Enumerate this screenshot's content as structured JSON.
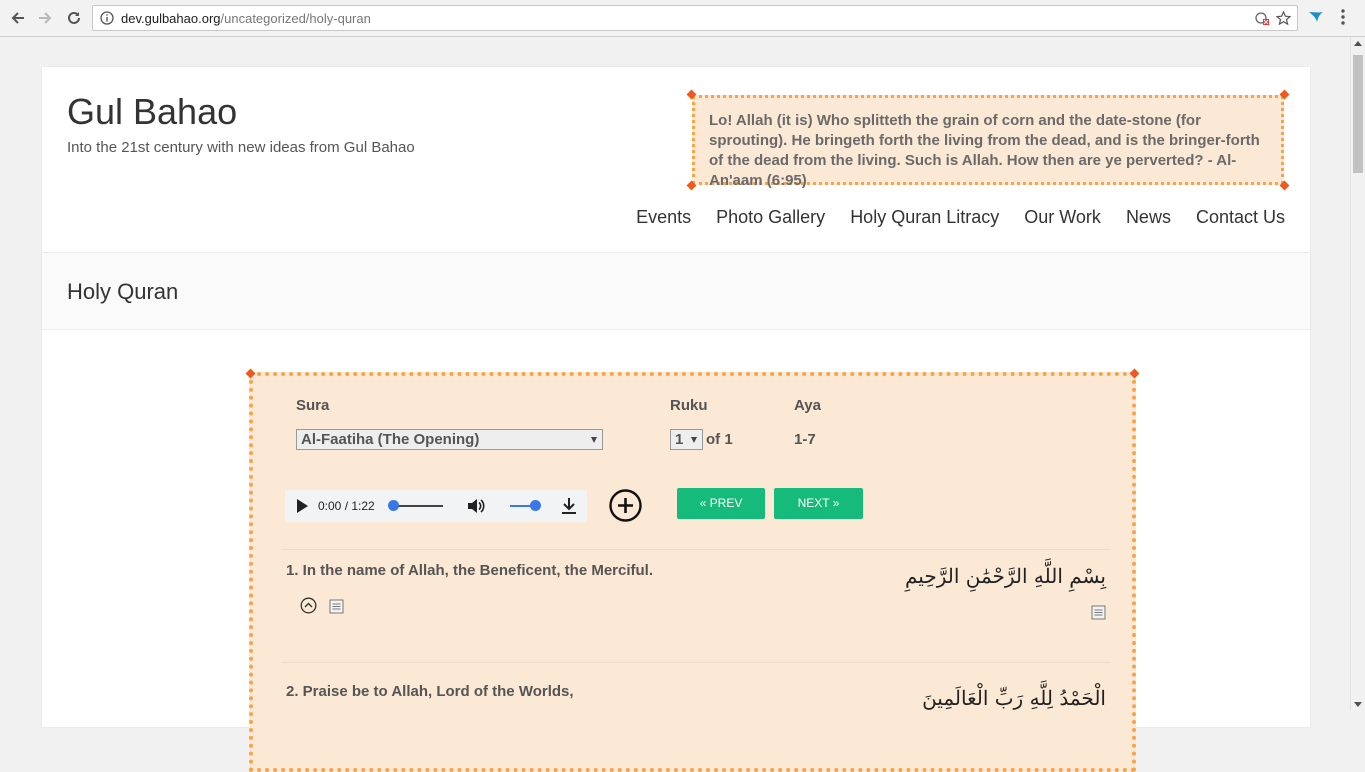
{
  "browser": {
    "url_host": "dev.gulbahao.org",
    "url_path": "/uncategorized/holy-quran"
  },
  "site": {
    "title": "Gul Bahao",
    "tagline": "Into the 21st century with new ideas from Gul Bahao",
    "quote": "Lo! Allah (it is) Who splitteth the grain of corn and the date-stone (for sprouting). He bringeth forth the living from the dead, and is the bringer-forth of the dead from the living. Such is Allah. How then are ye perverted? - Al-An'aam (6:95)"
  },
  "nav": {
    "items": [
      "Events",
      "Photo Gallery",
      "Holy Quran Litracy",
      "Our Work",
      "News",
      "Contact Us"
    ]
  },
  "page": {
    "title": "Holy Quran"
  },
  "quran": {
    "sura_label": "Sura",
    "sura_selected": "Al-Faatiha (The Opening)",
    "ruku_label": "Ruku",
    "ruku_selected": "1",
    "ruku_of": "of 1",
    "aya_label": "Aya",
    "aya_range": "1-7",
    "audio": {
      "time": "0:00 / 1:22",
      "volume": 1.0,
      "progress": 0.0
    },
    "prev_label": "« PREV",
    "next_label": "NEXT »",
    "verses": [
      {
        "en": "1. In the name of Allah, the Beneficent, the Merciful.",
        "ar": "بِسْمِ اللَّهِ الرَّحْمَٰنِ الرَّحِيمِ"
      },
      {
        "en": "2. Praise be to Allah, Lord of the Worlds,",
        "ar": "الْحَمْدُ لِلَّهِ رَبِّ الْعَالَمِينَ"
      }
    ]
  },
  "colors": {
    "accent_green": "#16bb7c",
    "panel_bg": "#fbe8d5",
    "panel_border": "#f6a44a",
    "corner": "#ef5a1c"
  }
}
